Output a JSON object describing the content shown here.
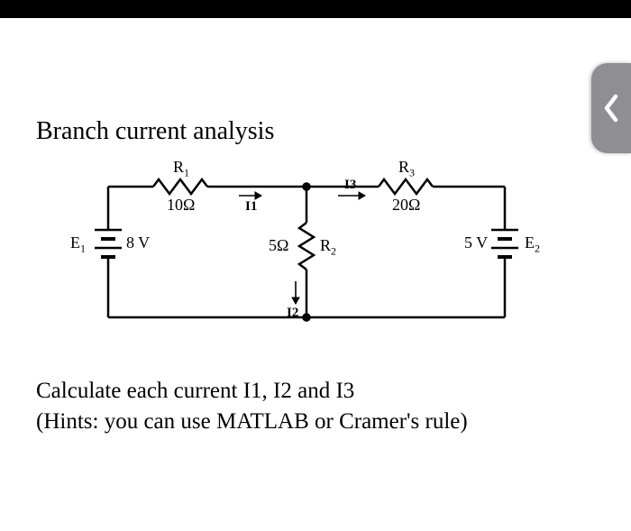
{
  "title": "Branch current analysis",
  "circuit": {
    "R1_label": "R",
    "R1_sub": "1",
    "R1_value": "10Ω",
    "R2_label": "R",
    "R2_sub": "2",
    "R2_value": "5Ω",
    "R3_label": "R",
    "R3_sub": "3",
    "R3_value": "20Ω",
    "E1_label": "E",
    "E1_sub": "1",
    "E1_value": "8 V",
    "E2_label": "E",
    "E2_sub": "2",
    "E2_value": "5 V",
    "I1_label": "I1",
    "I2_label": "I2",
    "I3_label": "I3"
  },
  "instruction_line1": "Calculate each current I1, I2 and I3",
  "instruction_line2": "(Hints: you can use MATLAB or Cramer's rule)",
  "chart_data": {
    "type": "circuit-diagram",
    "sources": [
      {
        "name": "E1",
        "voltage_V": 8,
        "position": "left"
      },
      {
        "name": "E2",
        "voltage_V": 5,
        "position": "right"
      }
    ],
    "resistors": [
      {
        "name": "R1",
        "ohms": 10,
        "position": "top-left-branch"
      },
      {
        "name": "R2",
        "ohms": 5,
        "position": "middle-branch"
      },
      {
        "name": "R3",
        "ohms": 20,
        "position": "top-right-branch"
      }
    ],
    "currents": [
      {
        "name": "I1",
        "direction": "right",
        "through": "R1"
      },
      {
        "name": "I2",
        "direction": "down",
        "through": "R2"
      },
      {
        "name": "I3",
        "direction": "right",
        "through": "R3"
      }
    ]
  }
}
